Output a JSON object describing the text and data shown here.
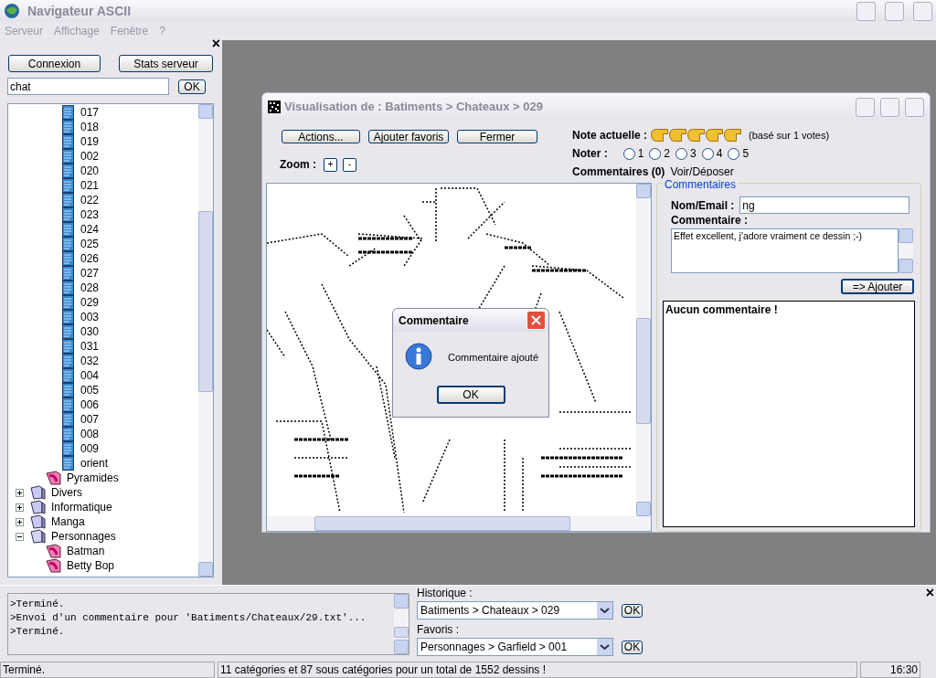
{
  "window": {
    "title": "Navigateur ASCII"
  },
  "menu": [
    "Serveur",
    "Affichage",
    "Fenêtre",
    "?"
  ],
  "left_panel": {
    "close": "×",
    "buttons": [
      "Connexion",
      "Stats serveur"
    ],
    "search": {
      "value": "chat",
      "button": "OK"
    },
    "tree": [
      {
        "kind": "hidden",
        "children": [
          {
            "kind": "hidden",
            "children": [
              {
                "kind": "drawing",
                "label": "017"
              },
              {
                "kind": "drawing",
                "label": "018"
              },
              {
                "kind": "drawing",
                "label": "019"
              },
              {
                "kind": "drawing",
                "label": "002"
              },
              {
                "kind": "drawing",
                "label": "020"
              },
              {
                "kind": "drawing",
                "label": "021"
              },
              {
                "kind": "drawing",
                "label": "022"
              },
              {
                "kind": "drawing",
                "label": "023"
              },
              {
                "kind": "drawing",
                "label": "024"
              },
              {
                "kind": "drawing",
                "label": "025"
              },
              {
                "kind": "drawing",
                "label": "026"
              },
              {
                "kind": "drawing",
                "label": "027"
              },
              {
                "kind": "drawing",
                "label": "028"
              },
              {
                "kind": "drawing",
                "label": "029"
              },
              {
                "kind": "drawing",
                "label": "003"
              },
              {
                "kind": "drawing",
                "label": "030"
              },
              {
                "kind": "drawing",
                "label": "031"
              },
              {
                "kind": "drawing",
                "label": "032"
              },
              {
                "kind": "drawing",
                "label": "004"
              },
              {
                "kind": "drawing",
                "label": "005"
              },
              {
                "kind": "drawing",
                "label": "006"
              },
              {
                "kind": "drawing",
                "label": "007"
              },
              {
                "kind": "drawing",
                "label": "008"
              },
              {
                "kind": "drawing",
                "label": "009"
              },
              {
                "kind": "drawing",
                "label": "orient"
              }
            ]
          },
          {
            "kind": "category",
            "label": "Pyramides"
          }
        ]
      },
      {
        "kind": "folder",
        "label": "Divers",
        "expanded": false
      },
      {
        "kind": "folder",
        "label": "Informatique",
        "expanded": false
      },
      {
        "kind": "folder",
        "label": "Manga",
        "expanded": false
      },
      {
        "kind": "folder",
        "label": "Personnages",
        "expanded": true,
        "children": [
          {
            "kind": "category",
            "label": "Batman"
          },
          {
            "kind": "category",
            "label": "Betty Bop"
          }
        ]
      }
    ]
  },
  "viewer": {
    "title": "Visualisation de : Batiments > Chateaux > 029",
    "buttons": [
      "Actions...",
      "Ajouter favoris",
      "Fermer"
    ],
    "zoom_label": "Zoom :",
    "zoom_buttons": [
      "+",
      "-"
    ],
    "rating_label": "Note actuelle :",
    "rating": {
      "stars": 5
    },
    "rating_note": "(basé sur 1 votes)",
    "vote_label": "Noter :",
    "vote_options": [
      {
        "label": "1",
        "selected": false
      },
      {
        "label": "2",
        "selected": false
      },
      {
        "label": "3",
        "selected": false
      },
      {
        "label": "4",
        "selected": false
      },
      {
        "label": "5",
        "selected": false
      }
    ],
    "comments_label": "Commentaires (0)",
    "comments_link": "Voir/Déposer",
    "comment_form": {
      "legend": "Commentaires",
      "name_label": "Nom/Email :",
      "name_value": "ng",
      "comment_label": "Commentaire :",
      "comment_value": "Effet excellent, j'adore vraiment ce dessin ;-)",
      "submit": "=> Ajouter",
      "list_text": "Aucun commentaire !"
    }
  },
  "dialog": {
    "title": "Commentaire",
    "message": "Commentaire ajouté",
    "button": "OK"
  },
  "bottom_panel": {
    "close": "×",
    "log": [
      ">Terminé.",
      ">Envoi d'un commentaire pour 'Batiments/Chateaux/29.txt'...",
      ">Terminé."
    ],
    "history_label": "Historique :",
    "history_value": "Batiments > Chateaux > 029",
    "history_ok": "OK",
    "favorites_label": "Favoris :",
    "favorites_value": "Personnages > Garfield > 001",
    "favorites_ok": "OK"
  },
  "status_bar": [
    "Terminé.",
    "11 catégories et 87 sous catégories pour un total de 1552 dessins !",
    "16:30"
  ]
}
